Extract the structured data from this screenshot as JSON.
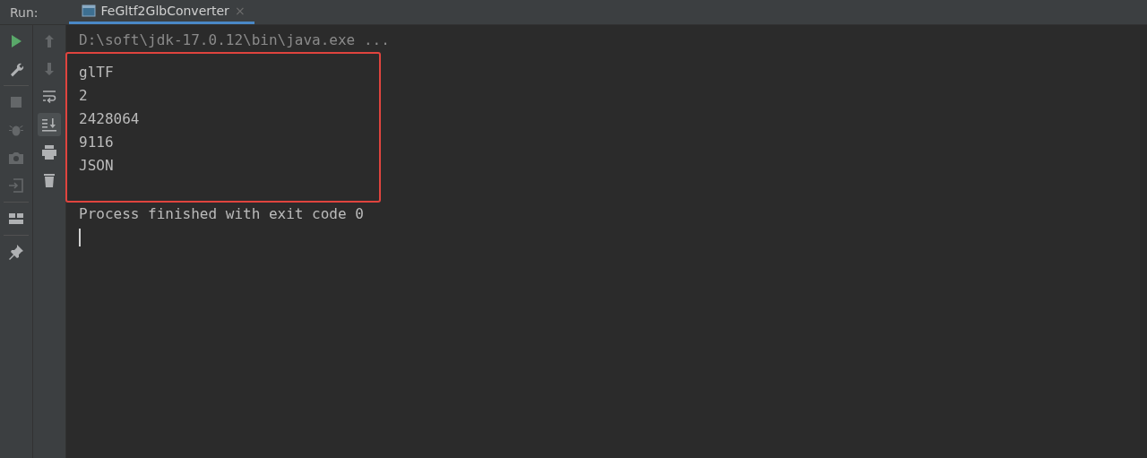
{
  "header": {
    "label": "Run:",
    "tab": {
      "title": "FeGltf2GlbConverter",
      "selected": true,
      "close": "×"
    }
  },
  "toolbar_main": [
    {
      "kind": "run",
      "disabled": false
    },
    {
      "kind": "settings",
      "disabled": false
    },
    {
      "kind": "stop",
      "disabled": true
    },
    {
      "kind": "debug",
      "disabled": true
    },
    {
      "kind": "camera",
      "disabled": true
    },
    {
      "kind": "exit",
      "disabled": true
    },
    {
      "kind": "layout",
      "disabled": false
    },
    {
      "kind": "pin",
      "disabled": false
    }
  ],
  "toolbar_console": [
    {
      "kind": "up",
      "disabled": true,
      "on": false
    },
    {
      "kind": "down",
      "disabled": true,
      "on": false
    },
    {
      "kind": "wrap",
      "disabled": false,
      "on": false
    },
    {
      "kind": "scroll-end",
      "disabled": false,
      "on": true
    },
    {
      "kind": "print",
      "disabled": false,
      "on": false
    },
    {
      "kind": "delete",
      "disabled": false,
      "on": false
    }
  ],
  "console": {
    "command": "D:\\soft\\jdk-17.0.12\\bin\\java.exe ...",
    "highlighted_lines": [
      "glTF",
      "2",
      "2428064",
      "9116",
      "JSON"
    ],
    "lines": [
      "Process finished with exit code 0"
    ],
    "cursor": true
  }
}
